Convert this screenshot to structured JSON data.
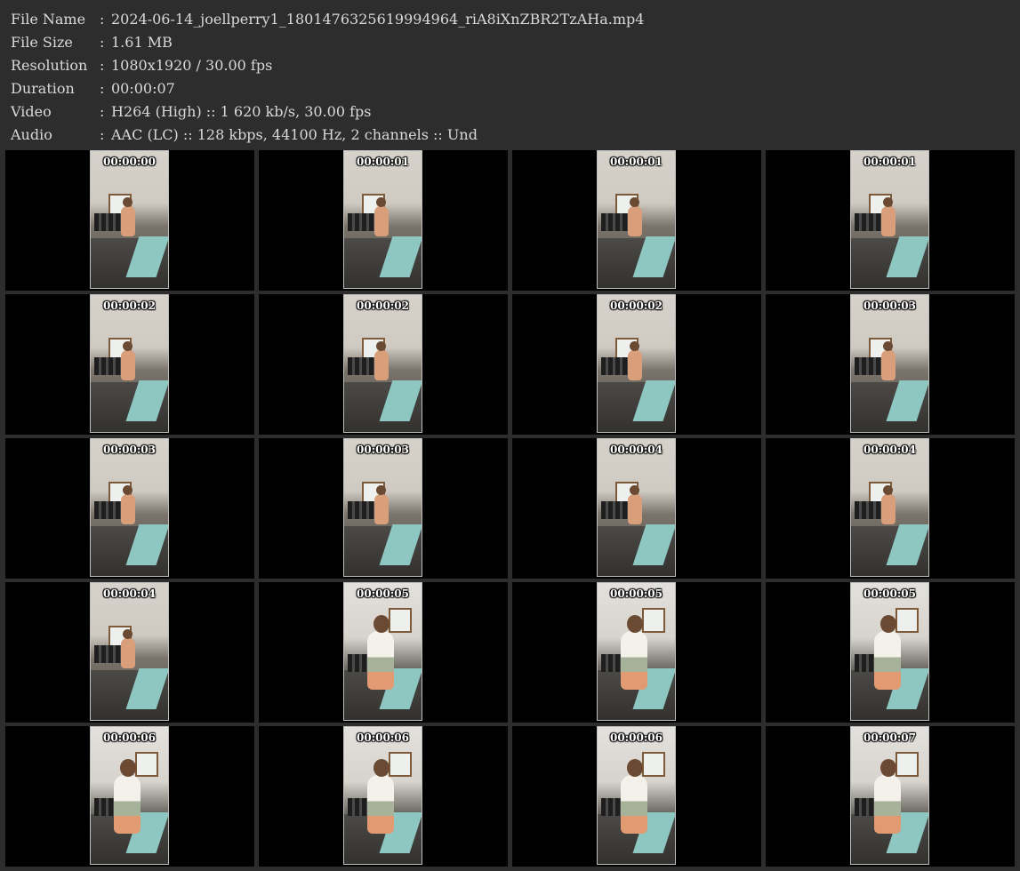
{
  "info": [
    {
      "key": "File Name",
      "sep": ":",
      "value": "2024-06-14_joellperry1_1801476325619994964_riA8iXnZBR2TzAHa.mp4"
    },
    {
      "key": "File Size",
      "sep": ":",
      "value": "1.61 MB"
    },
    {
      "key": "Resolution",
      "sep": ":",
      "value": "1080x1920 / 30.00 fps"
    },
    {
      "key": "Duration",
      "sep": ":",
      "value": "00:00:07"
    },
    {
      "key": "Video",
      "sep": ":",
      "value": "H264 (High) :: 1 620 kb/s, 30.00 fps"
    },
    {
      "key": "Audio",
      "sep": ":",
      "value": "AAC (LC) :: 128 kbps, 44100 Hz, 2 channels :: Und"
    }
  ],
  "frames": [
    {
      "timestamp": "00:00:00",
      "scene": "wide"
    },
    {
      "timestamp": "00:00:01",
      "scene": "wide"
    },
    {
      "timestamp": "00:00:01",
      "scene": "wide"
    },
    {
      "timestamp": "00:00:01",
      "scene": "wide"
    },
    {
      "timestamp": "00:00:02",
      "scene": "wide"
    },
    {
      "timestamp": "00:00:02",
      "scene": "wide"
    },
    {
      "timestamp": "00:00:02",
      "scene": "wide"
    },
    {
      "timestamp": "00:00:03",
      "scene": "wide"
    },
    {
      "timestamp": "00:00:03",
      "scene": "wide"
    },
    {
      "timestamp": "00:00:03",
      "scene": "wide"
    },
    {
      "timestamp": "00:00:04",
      "scene": "wide"
    },
    {
      "timestamp": "00:00:04",
      "scene": "wide"
    },
    {
      "timestamp": "00:00:04",
      "scene": "wide"
    },
    {
      "timestamp": "00:00:05",
      "scene": "close"
    },
    {
      "timestamp": "00:00:05",
      "scene": "close"
    },
    {
      "timestamp": "00:00:05",
      "scene": "close"
    },
    {
      "timestamp": "00:00:06",
      "scene": "close"
    },
    {
      "timestamp": "00:00:06",
      "scene": "close"
    },
    {
      "timestamp": "00:00:06",
      "scene": "close"
    },
    {
      "timestamp": "00:00:07",
      "scene": "close"
    }
  ]
}
